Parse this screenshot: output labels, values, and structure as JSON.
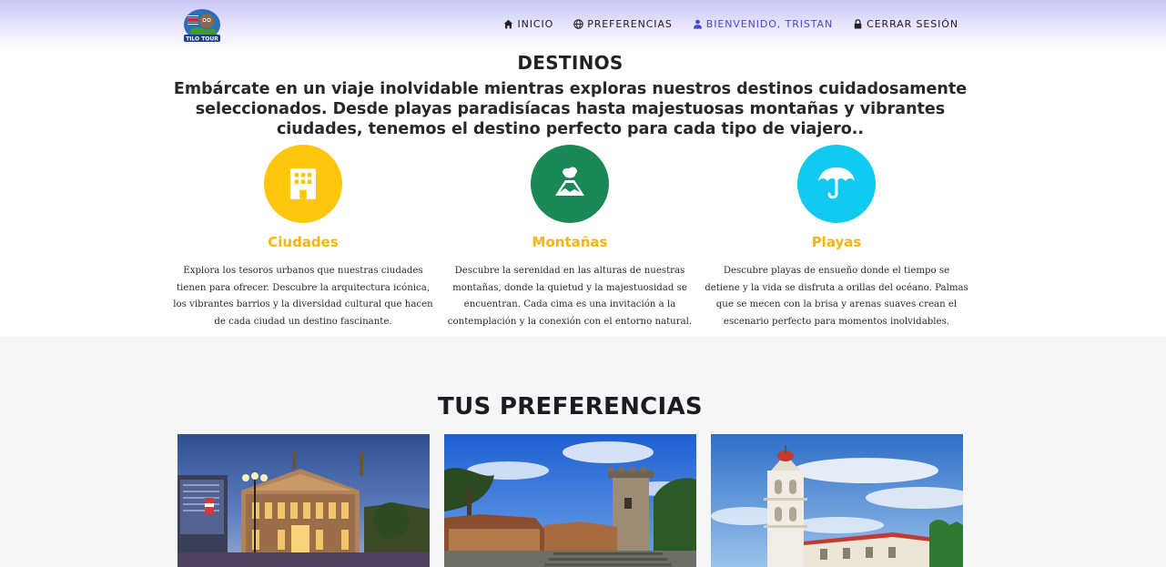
{
  "nav": {
    "logo_text": "TILO TOUR",
    "items": [
      {
        "label": "INICIO",
        "icon": "home-icon"
      },
      {
        "label": "PREFERENCIAS",
        "icon": "globe-icon"
      },
      {
        "label": "BIENVENIDO, TRISTAN",
        "icon": "user-icon"
      },
      {
        "label": "CERRAR SESIÓN",
        "icon": "lock-icon"
      }
    ]
  },
  "destinos": {
    "title": "DESTINOS",
    "intro": "Embárcate en un viaje inolvidable mientras exploras nuestros destinos cuidadosamente seleccionados. Desde playas paradisíacas hasta majestuosas montañas y vibrantes ciudades, tenemos el destino perfecto para cada tipo de viajero..",
    "cards": [
      {
        "title": "Ciudades",
        "icon": "building-icon",
        "color": "#fcc60a",
        "text": "Explora los tesoros urbanos que nuestras ciudades tienen para ofrecer. Descubre la arquitectura icónica, los vibrantes barrios y la diversidad cultural que hacen de cada ciudad un destino fascinante."
      },
      {
        "title": "Montañas",
        "icon": "volcano-icon",
        "color": "#1a8754",
        "text": "Descubre la serenidad en las alturas de nuestras montañas, donde la quietud y la majestuosidad se encuentran. Cada cima es una invitación a la contemplación y la conexión con el entorno natural."
      },
      {
        "title": "Playas",
        "icon": "umbrella-icon",
        "color": "#10caf0",
        "text": "Descubre playas de ensueño donde el tiempo se detiene y la vida se disfruta a orillas del océano. Palmas que se mecen con la brisa y arenas suaves crean el escenario perfecto para momentos inolvidables."
      }
    ]
  },
  "preferencias": {
    "title": "TUS PREFERENCIAS"
  },
  "colors": {
    "accent_title": "#f5b50a",
    "nav_active": "#4a48d8"
  }
}
